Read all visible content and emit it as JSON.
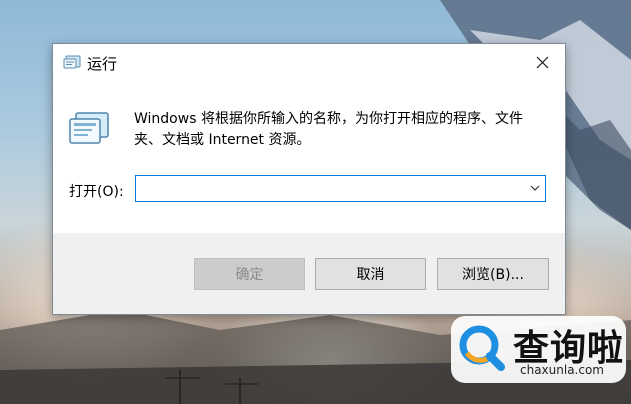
{
  "window": {
    "title": "运行",
    "close_glyph": "✕",
    "description": "Windows 将根据你所输入的名称，为你打开相应的程序、文件夹、文档或 Internet 资源。",
    "open_label": "打开(O):",
    "open_value": "",
    "buttons": {
      "ok": "确定",
      "cancel": "取消",
      "browse": "浏览(B)..."
    },
    "icon": "run-icon"
  },
  "watermark": {
    "brand_cn": "查询啦",
    "brand_en": "chaxunla.com",
    "colors": {
      "blue": "#1e8fe1",
      "orange": "#f5a623"
    }
  },
  "colors": {
    "focus_border": "#0078d7",
    "panel_bg": "#f0f0f0",
    "button_bg": "#e1e1e1",
    "disabled_button_bg": "#cccccc"
  }
}
